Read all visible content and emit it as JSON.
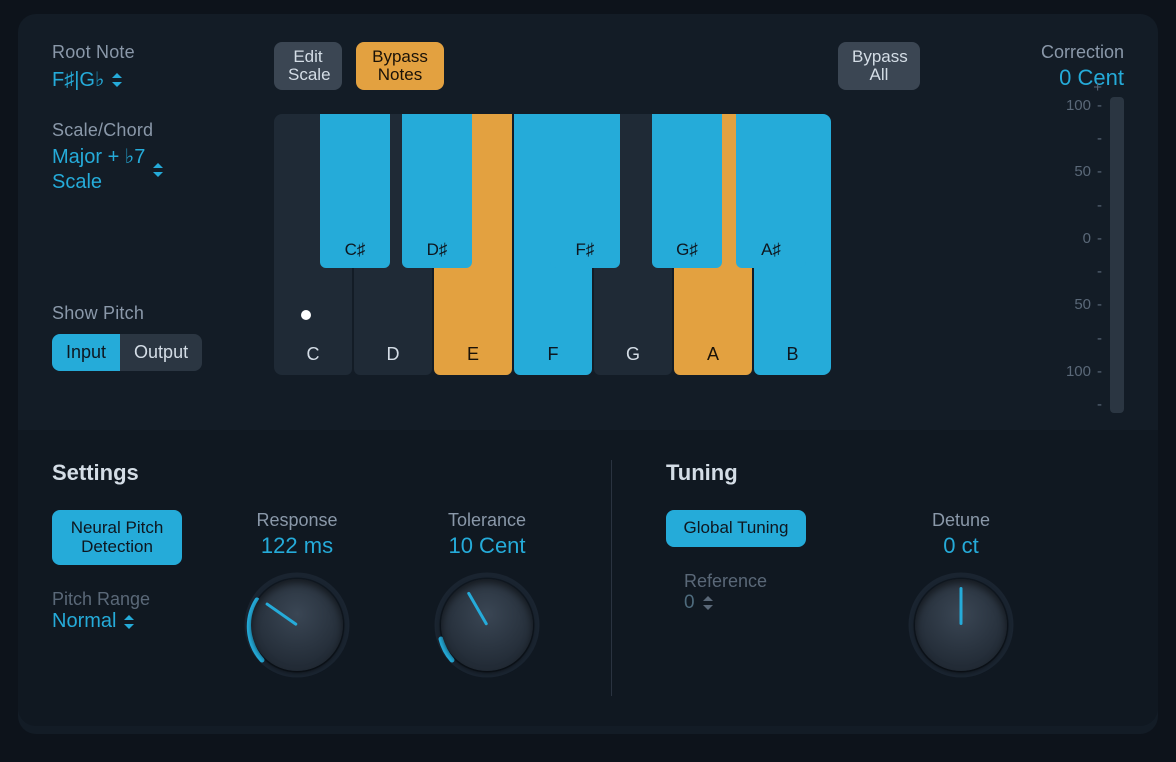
{
  "root_note": {
    "label": "Root Note",
    "value": "F♯|G♭"
  },
  "scale_chord": {
    "label": "Scale/Chord",
    "value_line1": "Major + ♭7",
    "value_line2": "Scale"
  },
  "show_pitch": {
    "label": "Show Pitch",
    "input": "Input",
    "output": "Output"
  },
  "toolbar": {
    "edit_scale": "Edit\nScale",
    "bypass_notes": "Bypass\nNotes",
    "bypass_all": "Bypass\nAll"
  },
  "keys": {
    "white": [
      {
        "label": "C",
        "state": "off"
      },
      {
        "label": "D",
        "state": "off"
      },
      {
        "label": "E",
        "state": "orange"
      },
      {
        "label": "F",
        "state": "cyan"
      },
      {
        "label": "G",
        "state": "off"
      },
      {
        "label": "A",
        "state": "orange"
      },
      {
        "label": "B",
        "state": "cyan"
      }
    ],
    "black": [
      {
        "label": "C♯",
        "state": "cyan"
      },
      {
        "label": "D♯",
        "state": "cyan"
      },
      {
        "label": "F♯",
        "state": "cyan"
      },
      {
        "label": "G♯",
        "state": "cyan"
      },
      {
        "label": "A♯",
        "state": "cyan"
      }
    ]
  },
  "correction": {
    "label": "Correction",
    "value": "0 Cent",
    "plus": "+",
    "ticks": [
      "100",
      "50",
      "0",
      "50",
      "100"
    ]
  },
  "settings": {
    "title": "Settings",
    "neural": "Neural Pitch\nDetection",
    "pitch_range_label": "Pitch Range",
    "pitch_range_value": "Normal",
    "response_label": "Response",
    "response_value": "122 ms",
    "tolerance_label": "Tolerance",
    "tolerance_value": "10 Cent"
  },
  "tuning": {
    "title": "Tuning",
    "global": "Global Tuning",
    "reference_label": "Reference",
    "reference_value": "0",
    "detune_label": "Detune",
    "detune_value": "0 ct"
  }
}
